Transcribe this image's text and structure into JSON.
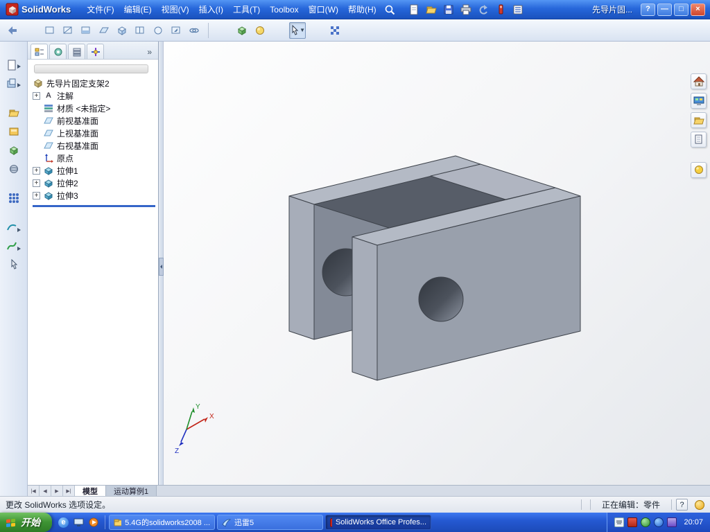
{
  "colors": {
    "titlebar_blue": "#2767DA",
    "toolbar_gray": "#D9E3F2",
    "taskbar_blue": "#2559D2",
    "start_green": "#3E9434",
    "rollback_blue": "#3565C8",
    "model_face_gray": "#99A0AC",
    "model_top_gray": "#B4BAC5",
    "model_slot_dark": "#575D68",
    "viewport_bg": "#F3F4F6"
  },
  "titlebar": {
    "app_name": "SolidWorks",
    "menus": [
      "文件(F)",
      "编辑(E)",
      "视图(V)",
      "插入(I)",
      "工具(T)",
      "Toolbox",
      "窗口(W)",
      "帮助(H)"
    ],
    "doc_title": "先导片固...",
    "help_glyph": "?",
    "minimize_glyph": "—",
    "maximize_glyph": "□",
    "close_glyph": "×"
  },
  "panel": {
    "chevron": "»",
    "root_label": "先导片固定支架2",
    "expander_glyph": "+",
    "annotation_glyph": "A",
    "items": [
      {
        "label": "注解"
      },
      {
        "label": "材质 <未指定>"
      },
      {
        "label": "前视基准面"
      },
      {
        "label": "上视基准面"
      },
      {
        "label": "右视基准面"
      },
      {
        "label": "原点"
      },
      {
        "label": "拉伸1"
      },
      {
        "label": "拉伸2"
      },
      {
        "label": "拉伸3"
      }
    ]
  },
  "viewport": {
    "triad": {
      "x": "X",
      "y": "Y",
      "z": "Z"
    }
  },
  "bottom_tabs": {
    "nav": [
      "|◀",
      "◀",
      "▶",
      "▶|"
    ],
    "model_tab": "模型",
    "motion_tab": "运动算例1"
  },
  "statusbar": {
    "message": "更改 SolidWorks 选项设定。",
    "editing": "正在编辑：零件",
    "help_glyph": "?"
  },
  "taskbar": {
    "start_label": "开始",
    "ie_glyph": "e",
    "tasks": [
      {
        "label": "5.4G的solidworks2008 ..."
      },
      {
        "label": "迅雷5"
      },
      {
        "label": "SolidWorks Office Profes..."
      }
    ],
    "clock": "20:07"
  }
}
